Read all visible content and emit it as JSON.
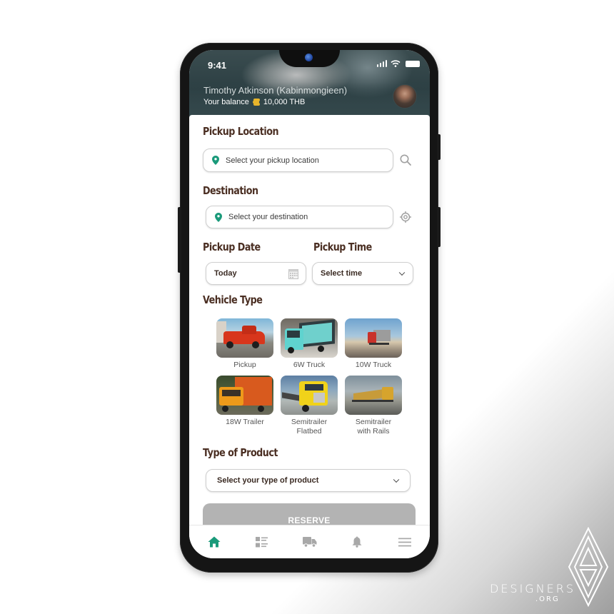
{
  "status_bar": {
    "time": "9:41"
  },
  "header": {
    "user_name": "Timothy Atkinson (Kabinmongieen)",
    "balance_label": "Your balance",
    "balance_value": "10,000 THB",
    "balance_icon": "coins-icon",
    "avatar": "user-avatar"
  },
  "pickup_location": {
    "title": "Pickup Location",
    "placeholder": "Select your pickup location",
    "side_icon": "search-icon"
  },
  "destination": {
    "title": "Destination",
    "placeholder": "Select your destination",
    "side_icon": "locate-icon"
  },
  "pickup_date": {
    "title": "Pickup Date",
    "value": "Today",
    "icon": "calendar-icon"
  },
  "pickup_time": {
    "title": "Pickup Time",
    "value": "Select time",
    "icon": "chevron-down-icon"
  },
  "vehicle_type": {
    "title": "Vehicle Type",
    "items": [
      {
        "label": "Pickup"
      },
      {
        "label": "6W Truck"
      },
      {
        "label": "10W Truck"
      },
      {
        "label": "18W Trailer"
      },
      {
        "label": "Semitrailer Flatbed"
      },
      {
        "label": "Semitrailer with Rails"
      }
    ]
  },
  "product_type": {
    "title": "Type of Product",
    "value": "Select your type of product"
  },
  "reserve_button": {
    "label": "RESERVE"
  },
  "tabbar": {
    "items": [
      {
        "name": "home",
        "icon": "home-icon",
        "active": true
      },
      {
        "name": "orders",
        "icon": "list-icon",
        "active": false
      },
      {
        "name": "delivery",
        "icon": "truck-icon",
        "active": false
      },
      {
        "name": "notifications",
        "icon": "bell-icon",
        "active": false
      },
      {
        "name": "menu",
        "icon": "menu-icon",
        "active": false
      }
    ]
  },
  "colors": {
    "accent": "#1a9a7a",
    "title_brown": "#4a2e22",
    "disabled_button": "#b3b3b3",
    "inactive_icon": "#a8a8a8"
  },
  "watermark": {
    "brand": "DESIGNERS",
    "suffix": ".ORG"
  }
}
